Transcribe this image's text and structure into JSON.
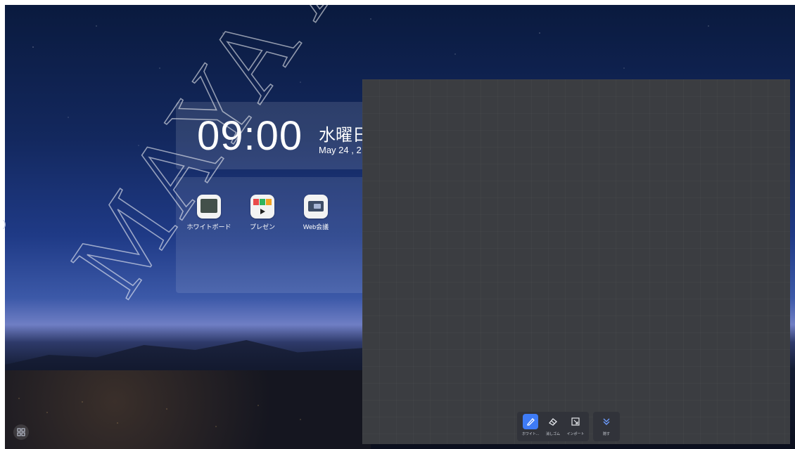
{
  "clock": {
    "time": "09:00",
    "weekday": "水曜日",
    "date": "May 24 , 2"
  },
  "apps": [
    {
      "label": "ホワイトボード"
    },
    {
      "label": "プレゼン"
    },
    {
      "label": "Web会議"
    }
  ],
  "toolbar": {
    "items": [
      {
        "label": "ホワイト..."
      },
      {
        "label": "消しゴム"
      },
      {
        "label": "インポート"
      }
    ],
    "collapse_label": "隠す"
  },
  "watermark": {
    "text": "MAYA ASYS"
  },
  "colors": {
    "accent": "#3e7bf6",
    "panel": "#3b3d41"
  }
}
